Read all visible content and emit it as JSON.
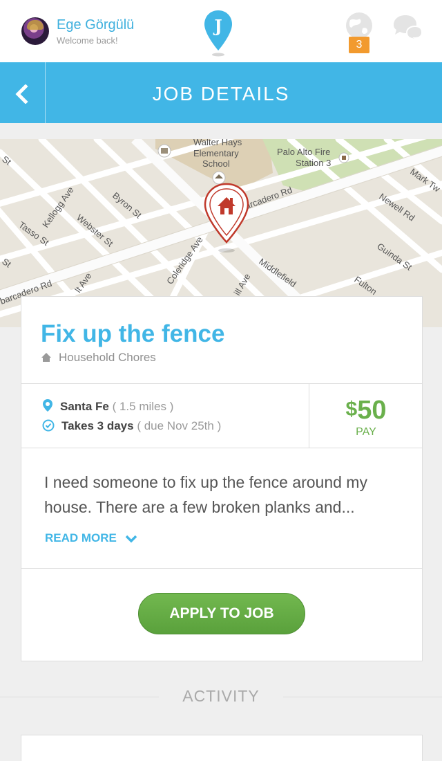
{
  "user": {
    "name": "Ege Görgülü",
    "subtitle": "Welcome back!"
  },
  "logo": {
    "letter": "J",
    "color": "#41b6e6"
  },
  "notifications": {
    "count": "3",
    "badge_color": "#f29a2e"
  },
  "header": {
    "title": "JOB DETAILS",
    "color": "#41b6e6"
  },
  "map": {
    "labels": [
      "Walter Hays",
      "Elementary",
      "School",
      "Palo Alto Fire",
      "Station 3",
      "Mark Tw",
      "Newell Rd",
      "Guinda St",
      "Fulton",
      "Middlefield",
      "barcadero Rd",
      "Coleridge Ave",
      "Byron St",
      "Webster St",
      "Kellogg Ave",
      "Tasso St",
      "barcadero Rd",
      "lt Ave",
      "ill Ave",
      "St",
      "St"
    ]
  },
  "job": {
    "title": "Fix up the fence",
    "category": "Household Chores",
    "location": "Santa Fe",
    "distance": "( 1.5 miles )",
    "duration": "Takes 3 days",
    "due": "( due Nov 25th )",
    "pay_currency": "$",
    "pay_amount": "50",
    "pay_label": "PAY",
    "description": "I need someone to fix up the fence around my house. There are a few broken planks and...",
    "read_more": "READ MORE",
    "apply_label": "APPLY TO JOB"
  },
  "activity": {
    "label": "ACTIVITY"
  },
  "colors": {
    "accent": "#41b6e6",
    "green": "#6ab04c",
    "pin_red": "#c0392b"
  }
}
